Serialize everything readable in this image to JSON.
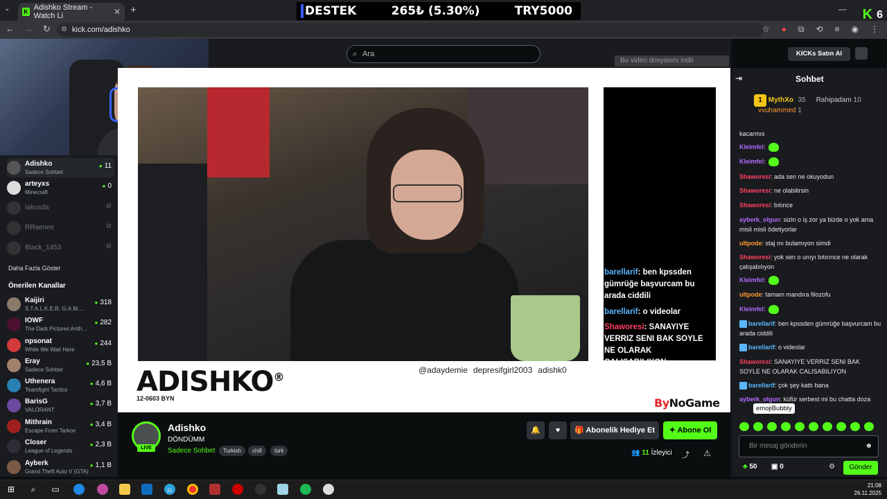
{
  "browser": {
    "tab_title": "Adishko Stream - Watch Li",
    "url": "kick.com/adishko",
    "new_tab": "+",
    "menu": "⌄"
  },
  "ticker": {
    "label1": "DESTEK",
    "label2": "265₺ (5.30%)",
    "label3": "TRY5000"
  },
  "kick_counter": "6",
  "search": {
    "placeholder": "Ara"
  },
  "download_bar": "Bu video dosyasını indir",
  "sidebar": {
    "following": [
      {
        "name": "Adishko",
        "sub": "Sadece Sohbet",
        "count": "11",
        "active": true
      },
      {
        "name": "arteyxs",
        "sub": "Minecraft",
        "count": "0"
      },
      {
        "name": "lakosda",
        "sub": "",
        "count": ""
      },
      {
        "name": "RRaenee",
        "sub": "",
        "count": ""
      },
      {
        "name": "Black_1453",
        "sub": "",
        "count": ""
      }
    ],
    "show_more": "Daha Fazla Göster",
    "recommended_title": "Önerilen Kanallar",
    "recommended": [
      {
        "name": "Kaijiri",
        "sub": "S.T.A.L.K.E.R. G.A.M.M.A.",
        "count": "318"
      },
      {
        "name": "IOWF",
        "sub": "The Dark Pictures Anthology",
        "count": "282"
      },
      {
        "name": "npsonat",
        "sub": "While We Wait Here",
        "count": "244"
      },
      {
        "name": "Eray",
        "sub": "Sadece Sohbet",
        "count": "23,5 B"
      },
      {
        "name": "Uthenera",
        "sub": "Teamfight Tactics",
        "count": "4,6 B"
      },
      {
        "name": "BarisG",
        "sub": "VALORANT",
        "count": "3,7 B"
      },
      {
        "name": "Mithrain",
        "sub": "Escape From Tarkov",
        "count": "3,4 B"
      },
      {
        "name": "Closer",
        "sub": "League of Legends",
        "count": "2,3 B"
      },
      {
        "name": "Ayberk",
        "sub": "Grand Theft Auto V (GTA)",
        "count": "1,1 B"
      }
    ]
  },
  "player": {
    "brand": "ADISHKO",
    "brand_mark": "®",
    "brand_sub": "12-0603 BYN",
    "socials": [
      "@adaydemie",
      "depresifgirl2003",
      "adishk0"
    ],
    "sponsor_a": "By",
    "sponsor_b": "NoGame",
    "overlay_chat": [
      {
        "user": "barellarif",
        "text": ": ben kpssden gümrüğe başvurcam bu arada ciddili",
        "type": "u1"
      },
      {
        "user": "barellarif",
        "text": ": o videolar",
        "type": "u1"
      },
      {
        "user": "Shaworesi",
        "text": ": SANAYIYE VERRIZ SENI BAK SOYLE NE OLARAK CALISABILIYON",
        "type": "u2"
      }
    ]
  },
  "channel": {
    "name": "Adishko",
    "title": "DÖNDÜMM",
    "category": "Sadece Sohbet",
    "live": "LIVE",
    "tags": [
      "Turkish",
      "chill",
      "türk"
    ],
    "gift_label": "Abonelik Hediye Et",
    "subscribe_label": "Abone Ol",
    "viewers_count": "11",
    "viewers_label": "İzleyici"
  },
  "chat": {
    "kicks_button": "KICKs Satın Al",
    "title": "Sohbet",
    "leaderboard": {
      "first": {
        "name": "MythXo",
        "points": "35",
        "rank": "1"
      },
      "second": {
        "name": "Rahipadam",
        "points": "10"
      },
      "third": {
        "name": "vvuhammed",
        "points": "1"
      }
    },
    "messages": [
      {
        "user": "",
        "text": "kacarmıs",
        "color": "#e8e8e8"
      },
      {
        "user": "Kleimfel",
        "text": ":",
        "color": "#b26cff",
        "emote": true
      },
      {
        "user": "Kleimfel",
        "text": ":",
        "color": "#b26cff",
        "emote": true
      },
      {
        "user": "Shaworesi",
        "text": ": ada sen ne okuyodun",
        "color": "#ff4060"
      },
      {
        "user": "Shaworesi",
        "text": ": ne olabilirsin",
        "color": "#ff4060"
      },
      {
        "user": "Shaworesi",
        "text": ": bıtınce",
        "color": "#ff4060"
      },
      {
        "user": "ayberk_olgun",
        "text": ": sizin o iş zor ya bizde o yok ama misli misli ödetiyorlar",
        "color": "#b26cff"
      },
      {
        "user": "ultpode",
        "text": ": staj mı bulamıyon simdi",
        "color": "#ff9a2e"
      },
      {
        "user": "Shaworesi",
        "text": ": yok sen o unıyı bıtırınce ne olarak çalışabılıyon",
        "color": "#ff4060"
      },
      {
        "user": "Kleimfel",
        "text": ":",
        "color": "#b26cff",
        "emote": true
      },
      {
        "user": "ultpode",
        "text": ": tamam mandıra filozofu",
        "color": "#ff9a2e"
      },
      {
        "user": "Kleimfel",
        "text": ":",
        "color": "#b26cff",
        "emote": true
      },
      {
        "user": "barellarif",
        "text": ": ben kpssden gümrüğe başvurcam bu arada ciddili",
        "color": "#5ab6ff",
        "badge": true
      },
      {
        "user": "barellarif",
        "text": ": o videolar",
        "color": "#5ab6ff",
        "badge": true
      },
      {
        "user": "Shaworesi",
        "text": ": SANAYIYE VERRIZ SENI BAK SOYLE NE OLARAK CALISABILIYON",
        "color": "#ff4060"
      },
      {
        "user": "barellarif",
        "text": ": çok şey kattı bana",
        "color": "#5ab6ff",
        "badge": true
      },
      {
        "user": "ayberk_olgun",
        "text": ": küfür serbest mi bu chatta doza",
        "color": "#b26cff"
      }
    ],
    "tooltip": "emojiBubbly",
    "input_placeholder": "Bir mesaj gönderin",
    "points": "50",
    "box_count": "0",
    "send_label": "Gönder"
  },
  "taskbar": {
    "time": "21:08",
    "date": "26.11.2025",
    "telegram_badge": "21"
  },
  "colors": {
    "accent": "#53fc18",
    "background": "#0b0e0f",
    "panel": "#191b1f"
  }
}
